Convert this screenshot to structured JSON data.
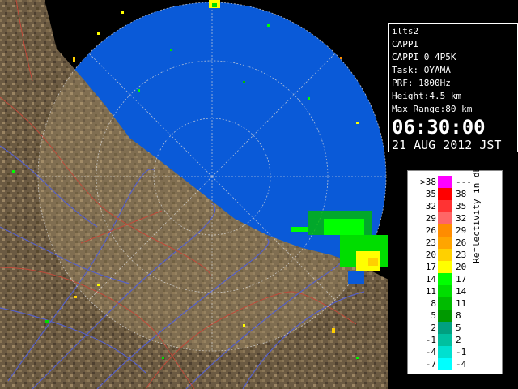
{
  "info": {
    "lines": [
      "ilts2",
      "CAPPI",
      "CAPPI_0_4P5K",
      "Task: OYAMA",
      "PRF: 1800Hz",
      "Height:4.5 km",
      "Max Range:80 km"
    ],
    "time": "06:30:00",
    "date": "21 AUG 2012 JST"
  },
  "legend": {
    "title": "Reflectivity in dBZ",
    "rows": [
      {
        "lo": ">38",
        "hi": "---",
        "color": "#ff00ff"
      },
      {
        "lo": "35",
        "hi": "38",
        "color": "#ff0000"
      },
      {
        "lo": "32",
        "hi": "35",
        "color": "#ff3333"
      },
      {
        "lo": "29",
        "hi": "32",
        "color": "#ff6666"
      },
      {
        "lo": "26",
        "hi": "29",
        "color": "#ff8c00"
      },
      {
        "lo": "23",
        "hi": "26",
        "color": "#ffa500"
      },
      {
        "lo": "20",
        "hi": "23",
        "color": "#ffd000"
      },
      {
        "lo": "17",
        "hi": "20",
        "color": "#ffff00"
      },
      {
        "lo": "14",
        "hi": "17",
        "color": "#00ff00"
      },
      {
        "lo": "11",
        "hi": "14",
        "color": "#00dd00"
      },
      {
        "lo": "8",
        "hi": "11",
        "color": "#00bb00"
      },
      {
        "lo": "5",
        "hi": "8",
        "color": "#009900"
      },
      {
        "lo": "2",
        "hi": "5",
        "color": "#00a080"
      },
      {
        "lo": "-1",
        "hi": "2",
        "color": "#00c0a0"
      },
      {
        "lo": "-4",
        "hi": "-1",
        "color": "#00e0d0"
      },
      {
        "lo": "-7",
        "hi": "-4",
        "color": "#00ffff"
      }
    ]
  },
  "colors": {
    "sea": "#0a5ad8",
    "land": "#6b5a42",
    "river": "#5560c8",
    "boundary": "#c04a3a"
  }
}
